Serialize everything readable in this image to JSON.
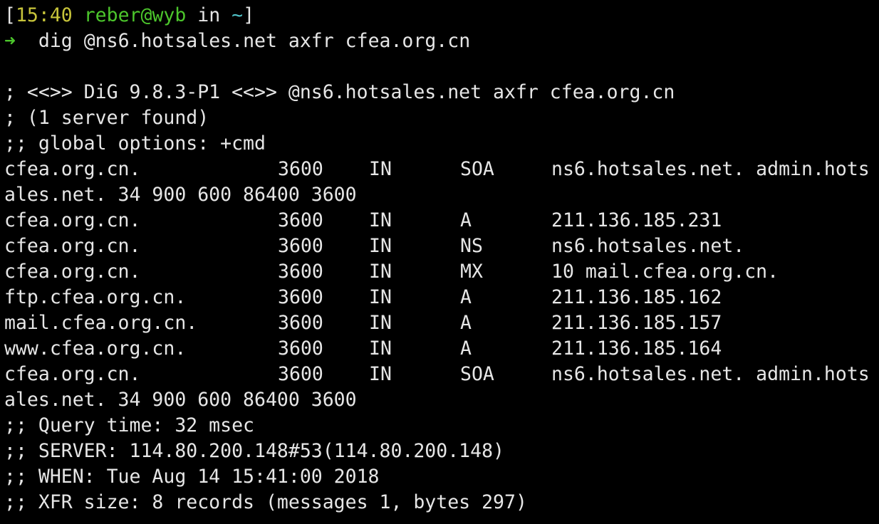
{
  "prompt": {
    "time_open": "[",
    "time": "15:40",
    "user_host": "reber@wyb",
    "in_word": "in",
    "dir": "~",
    "close": "]",
    "arrow": "➜",
    "command": "dig @ns6.hotsales.net axfr cfea.org.cn"
  },
  "header": [
    "; <<>> DiG 9.8.3-P1 <<>> @ns6.hotsales.net axfr cfea.org.cn",
    "; (1 server found)",
    ";; global options: +cmd"
  ],
  "records": [
    {
      "name": "cfea.org.cn.",
      "ttl": "3600",
      "class": "IN",
      "type": "SOA",
      "data": "ns6.hotsales.net. admin.hots",
      "wrap": "ales.net. 34 900 600 86400 3600"
    },
    {
      "name": "cfea.org.cn.",
      "ttl": "3600",
      "class": "IN",
      "type": "A",
      "data": "211.136.185.231"
    },
    {
      "name": "cfea.org.cn.",
      "ttl": "3600",
      "class": "IN",
      "type": "NS",
      "data": "ns6.hotsales.net."
    },
    {
      "name": "cfea.org.cn.",
      "ttl": "3600",
      "class": "IN",
      "type": "MX",
      "data": "10 mail.cfea.org.cn."
    },
    {
      "name": "ftp.cfea.org.cn.",
      "ttl": "3600",
      "class": "IN",
      "type": "A",
      "data": "211.136.185.162"
    },
    {
      "name": "mail.cfea.org.cn.",
      "ttl": "3600",
      "class": "IN",
      "type": "A",
      "data": "211.136.185.157"
    },
    {
      "name": "www.cfea.org.cn.",
      "ttl": "3600",
      "class": "IN",
      "type": "A",
      "data": "211.136.185.164"
    },
    {
      "name": "cfea.org.cn.",
      "ttl": "3600",
      "class": "IN",
      "type": "SOA",
      "data": "ns6.hotsales.net. admin.hots",
      "wrap": "ales.net. 34 900 600 86400 3600"
    }
  ],
  "footer": [
    ";; Query time: 32 msec",
    ";; SERVER: 114.80.200.148#53(114.80.200.148)",
    ";; WHEN: Tue Aug 14 15:41:00 2018",
    ";; XFR size: 8 records (messages 1, bytes 297)"
  ],
  "colors": {
    "background": "#000000",
    "text": "#e6e6e6",
    "time": "#c7c43a",
    "user_host": "#4cc62c",
    "dir": "#4fc3c9",
    "arrow": "#4cc62c"
  }
}
